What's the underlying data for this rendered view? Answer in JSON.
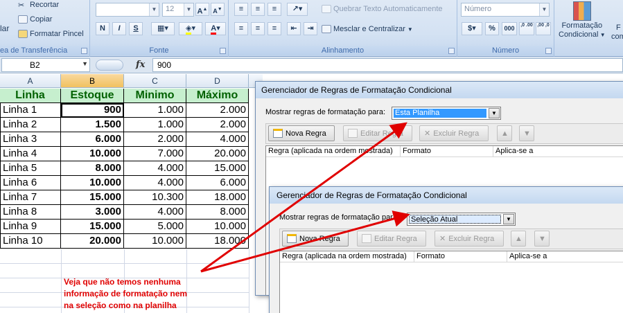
{
  "ribbon": {
    "clipboard": {
      "cut": "Recortar",
      "copy": "Copiar",
      "format_painter": "Formatar Pincel",
      "paste_fragment": "lar",
      "label": "ea de Transferência"
    },
    "font": {
      "size": "12",
      "label": "Fonte",
      "bold": "N",
      "italic": "I",
      "underline": "S"
    },
    "alignment": {
      "wrap": "Quebrar Texto Automaticamente",
      "merge": "Mesclar e Centralizar",
      "label": "Alinhamento"
    },
    "number": {
      "format": "Número",
      "percent": "%",
      "thousands": "000",
      "inc": ",0 .00",
      "dec": ",00 ,0",
      "label": "Número"
    },
    "styles": {
      "conditional_line1": "Formatação",
      "conditional_line2": "Condicional",
      "next_line1": "F",
      "next_line2": "com"
    }
  },
  "formula_bar": {
    "name_box": "B2",
    "fx": "fx",
    "value": "900"
  },
  "sheet": {
    "columns": [
      "A",
      "B",
      "C",
      "D"
    ],
    "header": [
      "Linha",
      "Estoque",
      "Minimo",
      "Máximo"
    ],
    "rows": [
      [
        "Linha 1",
        "900",
        "1.000",
        "2.000"
      ],
      [
        "Linha 2",
        "1.500",
        "1.000",
        "2.000"
      ],
      [
        "Linha 3",
        "6.000",
        "2.000",
        "4.000"
      ],
      [
        "Linha 4",
        "10.000",
        "7.000",
        "20.000"
      ],
      [
        "Linha 5",
        "8.000",
        "4.000",
        "15.000"
      ],
      [
        "Linha 6",
        "10.000",
        "4.000",
        "6.000"
      ],
      [
        "Linha 7",
        "15.000",
        "10.300",
        "18.000"
      ],
      [
        "Linha 8",
        "3.000",
        "4.000",
        "8.000"
      ],
      [
        "Linha 9",
        "15.000",
        "5.000",
        "10.000"
      ],
      [
        "Linha 10",
        "20.000",
        "10.000",
        "18.000"
      ]
    ],
    "note_lines": [
      "Veja que não temos nenhuma",
      "informação de formatação nem",
      "na seleção como na planilha"
    ]
  },
  "dialog1": {
    "title": "Gerenciador de Regras de Formatação Condicional",
    "show_label": "Mostrar regras de formatação para:",
    "show_value": "Esta Planilha",
    "buttons": {
      "new": "Nova Regra",
      "edit": "Editar Regra",
      "delete": "Excluir Regra"
    },
    "columns": [
      "Regra (aplicada na ordem mostrada)",
      "Formato",
      "Aplica-se a"
    ]
  },
  "dialog2": {
    "title": "Gerenciador de Regras de Formatação Condicional",
    "show_label": "Mostrar regras de formatação para:",
    "show_value": "Seleção Atual",
    "buttons": {
      "new": "Nova Regra",
      "edit": "Editar Regra",
      "delete": "Excluir Regra"
    },
    "columns": [
      "Regra (aplicada na ordem mostrada)",
      "Formato",
      "Aplica-se a"
    ]
  },
  "colors": {
    "header_fill": "#c6efce",
    "header_text": "#006100",
    "arrow": "#e00000",
    "selected_col": "#f1c15f"
  }
}
